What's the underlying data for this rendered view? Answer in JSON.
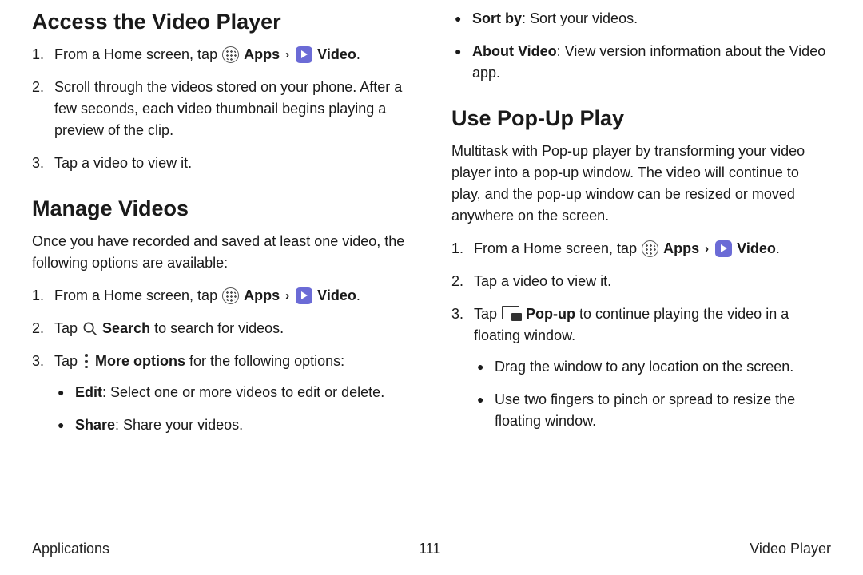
{
  "left": {
    "h_access": "Access the Video Player",
    "access_steps": [
      {
        "pre": "From a Home screen, tap ",
        "apps": "Apps",
        "video": "Video",
        "post": "."
      },
      {
        "text": "Scroll through the videos stored on your phone. After a few seconds, each video thumbnail begins playing a preview of the clip."
      },
      {
        "text": "Tap a video to view it."
      }
    ],
    "h_manage": "Manage Videos",
    "manage_intro": "Once you have recorded and saved at least one video, the following options are available:",
    "manage_steps": {
      "s1": {
        "pre": "From a Home screen, tap ",
        "apps": "Apps",
        "video": "Video",
        "post": "."
      },
      "s2": {
        "pre": "Tap ",
        "bold": "Search",
        "post": " to search for videos."
      },
      "s3": {
        "pre": "Tap ",
        "bold": "More options",
        "post": " for the following options:"
      }
    },
    "manage_bullets": [
      {
        "bold": "Edit",
        "text": ": Select one or more videos to edit or delete."
      },
      {
        "bold": "Share",
        "text": ": Share your videos."
      }
    ]
  },
  "right": {
    "top_bullets": [
      {
        "bold": "Sort by",
        "text": ": Sort your videos."
      },
      {
        "bold": "About Video",
        "text": ": View version information about the Video app."
      }
    ],
    "h_popup": "Use Pop-Up Play",
    "popup_intro": "Multitask with Pop-up player by transforming your video player into a pop-up window. The video will continue to play, and the pop-up window can be resized or moved anywhere on the screen.",
    "popup_steps": {
      "s1": {
        "pre": "From a Home screen, tap ",
        "apps": "Apps",
        "video": "Video",
        "post": "."
      },
      "s2": {
        "text": "Tap a video to view it."
      },
      "s3": {
        "pre": "Tap ",
        "bold": "Pop-up",
        "post": " to continue playing the video in a floating window."
      }
    },
    "popup_bullets": [
      {
        "text": "Drag the window to any location on the screen."
      },
      {
        "text": "Use two fingers to pinch or spread to resize the floating window."
      }
    ]
  },
  "footer": {
    "left": "Applications",
    "center": "111",
    "right": "Video Player"
  }
}
